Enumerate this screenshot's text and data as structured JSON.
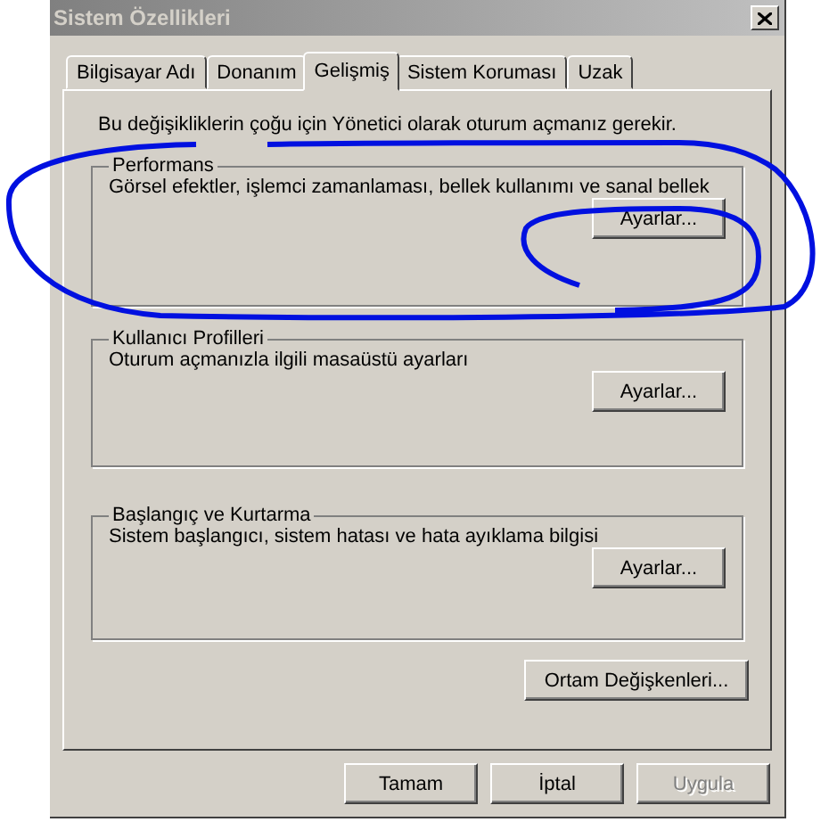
{
  "window": {
    "title": "Sistem Özellikleri"
  },
  "tabs": [
    {
      "label": "Bilgisayar Adı",
      "selected": false
    },
    {
      "label": "Donanım",
      "selected": false
    },
    {
      "label": "Gelişmiş",
      "selected": true
    },
    {
      "label": "Sistem Koruması",
      "selected": false
    },
    {
      "label": "Uzak",
      "selected": false
    }
  ],
  "notice": "Bu değişikliklerin çoğu için Yönetici olarak oturum açmanız gerekir.",
  "groups": [
    {
      "title": "Performans",
      "description": "Görsel efektler, işlemci zamanlaması, bellek kullanımı ve sanal bellek",
      "button": "Ayarlar..."
    },
    {
      "title": "Kullanıcı Profilleri",
      "description": "Oturum açmanızla ilgili masaüstü ayarları",
      "button": "Ayarlar..."
    },
    {
      "title": "Başlangıç ve Kurtarma",
      "description": "Sistem başlangıcı, sistem hatası ve hata ayıklama bilgisi",
      "button": "Ayarlar..."
    }
  ],
  "environment_button": "Ortam Değişkenleri...",
  "buttons": [
    {
      "label": "Tamam",
      "disabled": false
    },
    {
      "label": "İptal",
      "disabled": false
    },
    {
      "label": "Uygula",
      "disabled": true
    }
  ]
}
